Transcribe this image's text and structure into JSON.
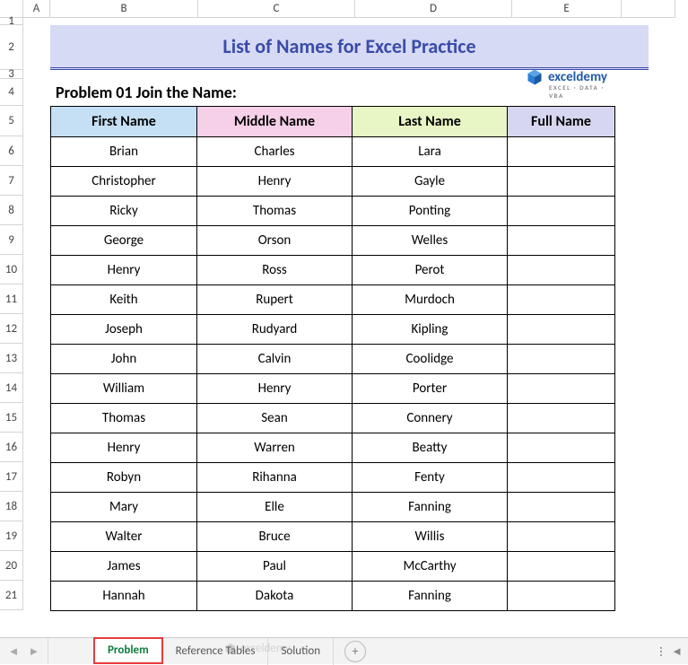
{
  "cols": [
    "A",
    "B",
    "C",
    "D",
    "E"
  ],
  "rows_visible": [
    "1",
    "2",
    "3",
    "4",
    "5",
    "6",
    "7",
    "8",
    "9",
    "10",
    "11",
    "12",
    "13",
    "14",
    "15",
    "16",
    "17",
    "18",
    "19",
    "20",
    "21"
  ],
  "title": "List of Names for Excel Practice",
  "problem_title": "Problem 01 Join the Name:",
  "logo": {
    "text": "exceldemy",
    "tag": "EXCEL · DATA · VBA"
  },
  "headers": {
    "first": "First Name",
    "middle": "Middle Name",
    "last": "Last Name",
    "full": "Full Name"
  },
  "rows": [
    {
      "first": "Brian",
      "middle": "Charles",
      "last": "Lara",
      "full": ""
    },
    {
      "first": "Christopher",
      "middle": "Henry",
      "last": "Gayle",
      "full": ""
    },
    {
      "first": "Ricky",
      "middle": "Thomas",
      "last": "Ponting",
      "full": ""
    },
    {
      "first": "George",
      "middle": "Orson",
      "last": "Welles",
      "full": ""
    },
    {
      "first": "Henry",
      "middle": "Ross",
      "last": "Perot",
      "full": ""
    },
    {
      "first": "Keith",
      "middle": "Rupert",
      "last": "Murdoch",
      "full": ""
    },
    {
      "first": "Joseph",
      "middle": "Rudyard",
      "last": "Kipling",
      "full": ""
    },
    {
      "first": "John",
      "middle": "Calvin",
      "last": "Coolidge",
      "full": ""
    },
    {
      "first": "William",
      "middle": "Henry",
      "last": "Porter",
      "full": ""
    },
    {
      "first": "Thomas",
      "middle": "Sean",
      "last": "Connery",
      "full": ""
    },
    {
      "first": "Henry",
      "middle": "Warren",
      "last": "Beatty",
      "full": ""
    },
    {
      "first": "Robyn",
      "middle": "Rihanna",
      "last": "Fenty",
      "full": ""
    },
    {
      "first": "Mary",
      "middle": "Elle",
      "last": "Fanning",
      "full": ""
    },
    {
      "first": "Walter",
      "middle": "Bruce",
      "last": "Willis",
      "full": ""
    },
    {
      "first": "James",
      "middle": "Paul",
      "last": "McCarthy",
      "full": ""
    },
    {
      "first": "Hannah",
      "middle": "Dakota",
      "last": "Fanning",
      "full": ""
    }
  ],
  "tabs": {
    "active": "Problem",
    "others": [
      "Reference Tables",
      "Solution"
    ]
  },
  "nav": {
    "prev": "◄",
    "next": "►",
    "add": "+",
    "scroll_left": "◄"
  },
  "watermark": "exceldemy"
}
